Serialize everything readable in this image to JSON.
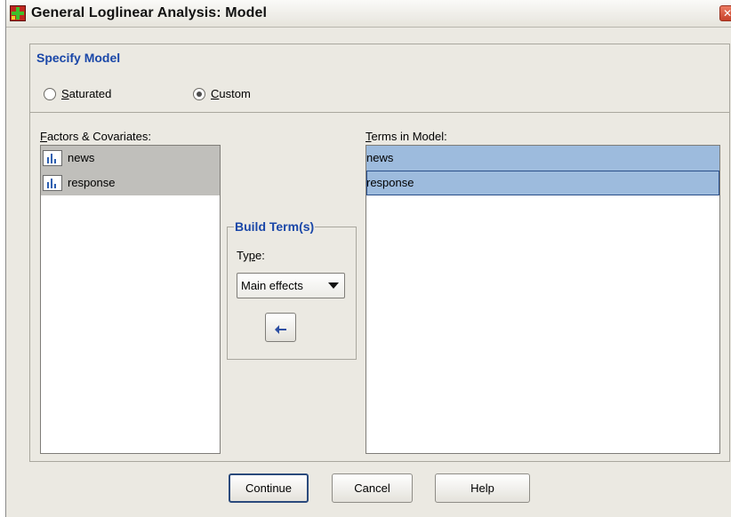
{
  "window": {
    "title": "General Loglinear Analysis: Model",
    "close_glyph": "✕"
  },
  "specify_model": {
    "title": "Specify Model",
    "options": [
      {
        "mnemonic": "S",
        "rest": "aturated",
        "checked": false
      },
      {
        "mnemonic": "C",
        "rest": "ustom",
        "checked": true
      }
    ]
  },
  "factors": {
    "label_mnemonic": "F",
    "label_rest": "actors & Covariates:",
    "items": [
      "news",
      "response"
    ]
  },
  "terms": {
    "label_mnemonic": "T",
    "label_rest": "erms in Model:",
    "items": [
      "news",
      "response"
    ],
    "selected_index": 1
  },
  "build_terms": {
    "title": "Build Term(s)",
    "type_label_pre": "Ty",
    "type_label_mnemonic": "p",
    "type_label_post": "e:",
    "type_value": "Main effects"
  },
  "buttons": {
    "continue": "Continue",
    "cancel": "Cancel",
    "help": "Help"
  },
  "colors": {
    "group_title": "#1a47a8",
    "terms_highlight": "#9dbbdd",
    "factor_highlight": "#c0bfbb"
  }
}
